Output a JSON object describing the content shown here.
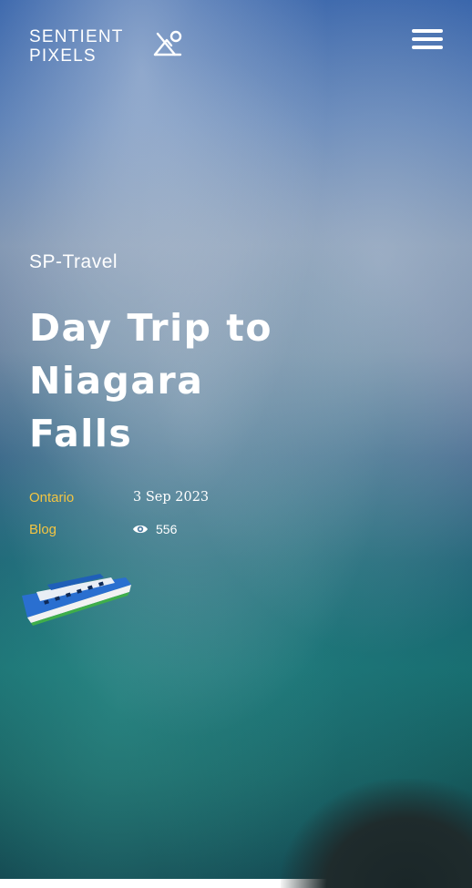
{
  "header": {
    "logo_line1": "SENTIENT",
    "logo_line2": "PIXELS",
    "logo_icon": "person-mountain-icon",
    "menu_icon": "hamburger-icon"
  },
  "post": {
    "category": "SP-Travel",
    "title": "Day Trip to Niagara Falls",
    "location": "Ontario",
    "date": "3 Sep 2023",
    "type": "Blog",
    "views": "556",
    "views_icon": "eye-icon"
  },
  "colors": {
    "accent": "#f4c542",
    "text": "#ffffff"
  }
}
